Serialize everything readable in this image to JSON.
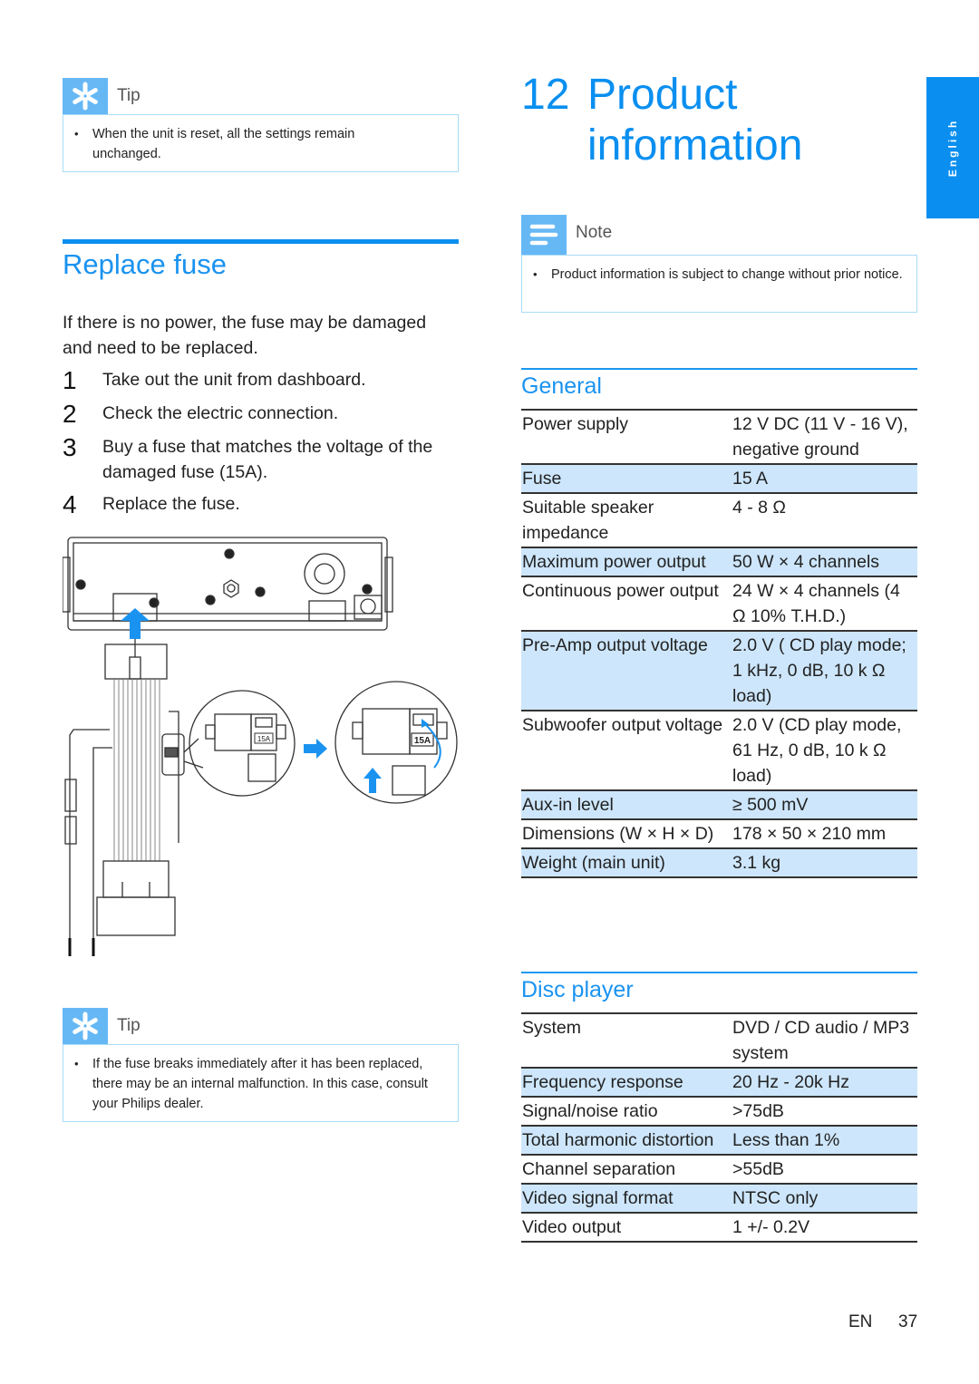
{
  "left": {
    "tip_top": {
      "label": "Tip",
      "icon": "asterisk-tip-icon",
      "text": "When the unit is reset, all the settings remain unchanged."
    },
    "section_title": "Replace fuse",
    "intro": "If there is no power, the fuse may be damaged and need to be replaced.",
    "steps": [
      {
        "num": "1",
        "text": "Take out the unit from dashboard."
      },
      {
        "num": "2",
        "text": "Check the electric connection."
      },
      {
        "num": "3",
        "text": "Buy a fuse that matches the voltage of the damaged fuse (15A)."
      },
      {
        "num": "4",
        "text": "Replace the fuse."
      }
    ],
    "figure": {
      "fuse_label_1": "15A",
      "fuse_label_2": "15A",
      "accent": "#1a93f0"
    },
    "tip_bottom": {
      "label": "Tip",
      "icon": "asterisk-tip-icon",
      "text": "If the fuse breaks immediately after it has been replaced, there may be an internal malfunction. In this case, consult your Philips dealer."
    }
  },
  "right": {
    "chapter_number": "12",
    "chapter_title_line1": "Product",
    "chapter_title_line2": "information",
    "note": {
      "label": "Note",
      "icon": "note-lines-icon",
      "text": "Product information is subject to change without prior notice."
    },
    "general": {
      "title": "General",
      "rows": [
        {
          "key": "Power supply",
          "value": "12 V DC (11 V - 16 V), negative ground",
          "shaded": false
        },
        {
          "key": "Fuse",
          "value": "15 A",
          "shaded": true
        },
        {
          "key": "Suitable speaker impedance",
          "value": "4 - 8 Ω",
          "shaded": false
        },
        {
          "key": "Maximum power output",
          "value": "50 W × 4 channels",
          "shaded": true
        },
        {
          "key": "Continuous power output",
          "value": "24 W × 4 channels (4 Ω 10% T.H.D.)",
          "shaded": false
        },
        {
          "key": "Pre-Amp output voltage",
          "value": "2.0 V ( CD play mode; 1 kHz, 0 dB, 10 k Ω load)",
          "shaded": true
        },
        {
          "key": "Subwoofer output voltage",
          "value": "2.0 V (CD play mode, 61 Hz, 0 dB, 10 k Ω load)",
          "shaded": false
        },
        {
          "key": "Aux-in level",
          "value": "≥ 500 mV",
          "shaded": true
        },
        {
          "key": "Dimensions (W × H × D)",
          "value": "178 × 50 × 210 mm",
          "shaded": false
        },
        {
          "key": "Weight (main unit)",
          "value": "3.1 kg",
          "shaded": true
        }
      ]
    },
    "disc_player": {
      "title": "Disc player",
      "rows": [
        {
          "key": "System",
          "value": "DVD / CD audio / MP3 system",
          "shaded": false
        },
        {
          "key": "Frequency response",
          "value": "20 Hz - 20k Hz",
          "shaded": true
        },
        {
          "key": "Signal/noise ratio",
          "value": ">75dB",
          "shaded": false
        },
        {
          "key": "Total harmonic distortion",
          "value": "Less than 1%",
          "shaded": true
        },
        {
          "key": "Channel separation",
          "value": ">55dB",
          "shaded": false
        },
        {
          "key": "Video signal format",
          "value": "NTSC only",
          "shaded": true
        },
        {
          "key": "Video output",
          "value": "1 +/- 0.2V",
          "shaded": false
        }
      ]
    }
  },
  "language_tab": "English",
  "footer": {
    "lang": "EN",
    "page": "37"
  },
  "colors": {
    "accent": "#0a8ff0",
    "row_shade": "#cde6fb",
    "callout_border": "#a9dcf6",
    "callout_icon_bg": "#66b8f5"
  }
}
